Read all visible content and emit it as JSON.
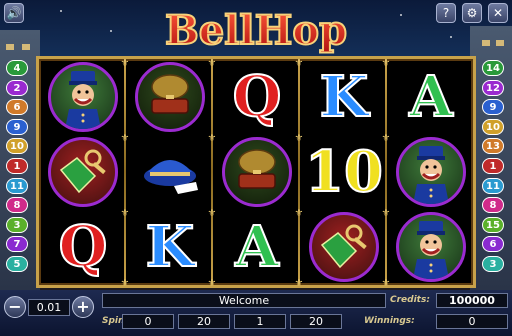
{
  "game": {
    "title": "BellHop"
  },
  "topbar": {
    "icons": [
      "speaker-icon",
      "help-icon",
      "settings-icon",
      "close-icon"
    ],
    "glyphs": [
      "🔊",
      "?",
      "⚙",
      "✕"
    ]
  },
  "reels": {
    "columns": [
      [
        "bellhop",
        "room-tag",
        "Q"
      ],
      [
        "suitcase",
        "hat",
        "K"
      ],
      [
        "Q",
        "suitcase",
        "A"
      ],
      [
        "K",
        "10",
        "room-tag"
      ],
      [
        "A",
        "bellhop",
        "bellhop"
      ]
    ],
    "letter_colors": {
      "Q": "#e02020",
      "K": "#2a8cff",
      "A": "#30c050",
      "10": "#f0e020"
    }
  },
  "lines": {
    "left": [
      {
        "n": "4",
        "color": "#2a9a3a"
      },
      {
        "n": "2",
        "color": "#9a2ad0"
      },
      {
        "n": "6",
        "color": "#d07a2a"
      },
      {
        "n": "9",
        "color": "#2a60d0"
      },
      {
        "n": "10",
        "color": "#d0a02a"
      },
      {
        "n": "1",
        "color": "#c02a2a"
      },
      {
        "n": "11",
        "color": "#2a9ad0"
      },
      {
        "n": "8",
        "color": "#d02a8a"
      },
      {
        "n": "3",
        "color": "#5ab02a"
      },
      {
        "n": "7",
        "color": "#8a2ad0"
      },
      {
        "n": "5",
        "color": "#2ab0a0"
      }
    ],
    "right": [
      {
        "n": "14",
        "color": "#2a9a3a"
      },
      {
        "n": "12",
        "color": "#9a2ad0"
      },
      {
        "n": "9",
        "color": "#2a60d0"
      },
      {
        "n": "10",
        "color": "#d0a02a"
      },
      {
        "n": "13",
        "color": "#d07a2a"
      },
      {
        "n": "1",
        "color": "#c02a2a"
      },
      {
        "n": "11",
        "color": "#2a9ad0"
      },
      {
        "n": "8",
        "color": "#d02a8a"
      },
      {
        "n": "15",
        "color": "#5ab02a"
      },
      {
        "n": "6",
        "color": "#8a2ad0"
      },
      {
        "n": "3",
        "color": "#2ab0a0"
      },
      {
        "n": "15",
        "color": "#c02a8a"
      }
    ]
  },
  "bottom": {
    "bet_value": "0.01",
    "minus": "−",
    "plus": "+",
    "message": "Welcome",
    "credits_label": "Credits:",
    "credits_value": "100000",
    "spins_label": "Spins:",
    "spins_value": "0",
    "lines_value": "20",
    "bet_mult_value": "1",
    "total_value": "20",
    "winnings_label": "Winnings:",
    "winnings_value": "0"
  }
}
